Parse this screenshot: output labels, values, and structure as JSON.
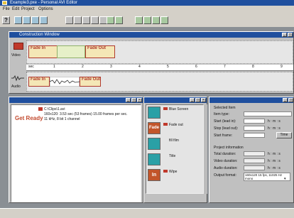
{
  "app": {
    "title": "Example3.pxe - Personal AVI Editor",
    "menu": [
      "File",
      "Edit",
      "Project",
      "Options"
    ],
    "help_label": "?"
  },
  "construction": {
    "title": "Construction Window",
    "video_label": "Video",
    "audio_label": "Audio",
    "ruler_label": "sec",
    "ruler_ticks": [
      "1",
      "2",
      "3",
      "4",
      "5",
      "6",
      "7",
      "8",
      "9"
    ],
    "video_clips": [
      {
        "label": "Fade In"
      },
      {
        "label": "Fade Out"
      }
    ],
    "audio_clips": [
      {
        "label": "Fade In"
      },
      {
        "label": "Fade Out"
      }
    ]
  },
  "clip_window": {
    "status": "Get Ready",
    "file": "C:\\Clips\\1.avi",
    "line1": "160x120: 3.53 sec (53 frames) 15.00 frames per sec.",
    "line2": "11 kHz, 8 bit 1 channel"
  },
  "effects": {
    "items": [
      {
        "label": "Blue Screen",
        "color": "#2aa0a6"
      },
      {
        "label": "Fade out",
        "color": "#c2552a"
      },
      {
        "label": "fill film",
        "color": "#2aa0a6"
      },
      {
        "label": "Title",
        "color": "#2aa0a6"
      },
      {
        "label": "Wipe",
        "color": "#c2552a"
      }
    ],
    "thumb_texts": [
      "",
      "Fade",
      "",
      "",
      "In"
    ]
  },
  "info": {
    "selected_item": "Selected Item",
    "item_type": "Item type:",
    "start_lead_in": "Start (lead in):",
    "stop_lead_out": "Stop (lead out):",
    "start_frame": "Start frame:",
    "hms": "h : m : s",
    "time_btn": "Time",
    "project_info": "Project information",
    "total_duration": "Total duration:",
    "video_duration": "Video duration:",
    "audio_duration": "Audio duration:",
    "output_format": "Output format:",
    "output_value": "160x120 15 fps, 11025 Hz mono"
  }
}
